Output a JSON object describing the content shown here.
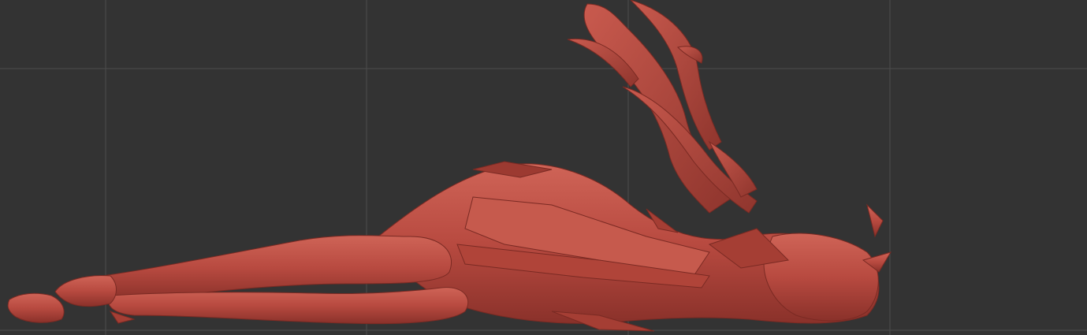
{
  "viewport": {
    "background_color": "#333333",
    "grid_color": "#505050",
    "model_color": "#b84a40",
    "model_highlight_color": "#d2685b",
    "model_shadow_color": "#7f2a24"
  },
  "model": {
    "subject": "reclining-figure-sculpt",
    "material": "red-clay"
  }
}
